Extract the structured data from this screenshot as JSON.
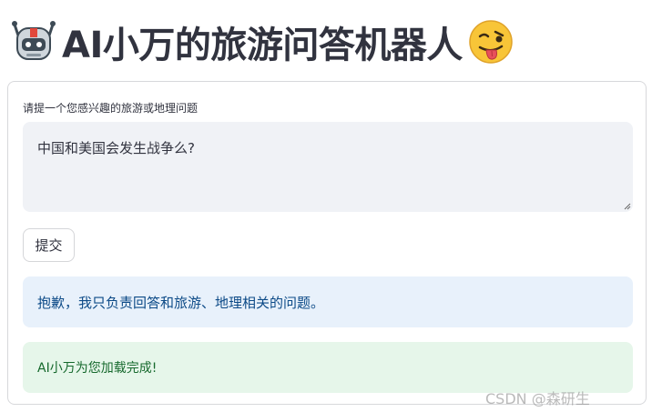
{
  "header": {
    "left_icon": "robot-icon",
    "title": "AI小万的旅游问答机器人",
    "right_icon": "winking-face-tongue-icon"
  },
  "form": {
    "input_label": "请提一个您感兴趣的旅游或地理问题",
    "input_value": "中国和美国会发生战争么?",
    "submit_label": "提交"
  },
  "messages": {
    "info": "抱歉，我只负责回答和旅游、地理相关的问题。",
    "success": "AI小万为您加载完成!"
  },
  "watermark": "CSDN @森研生"
}
